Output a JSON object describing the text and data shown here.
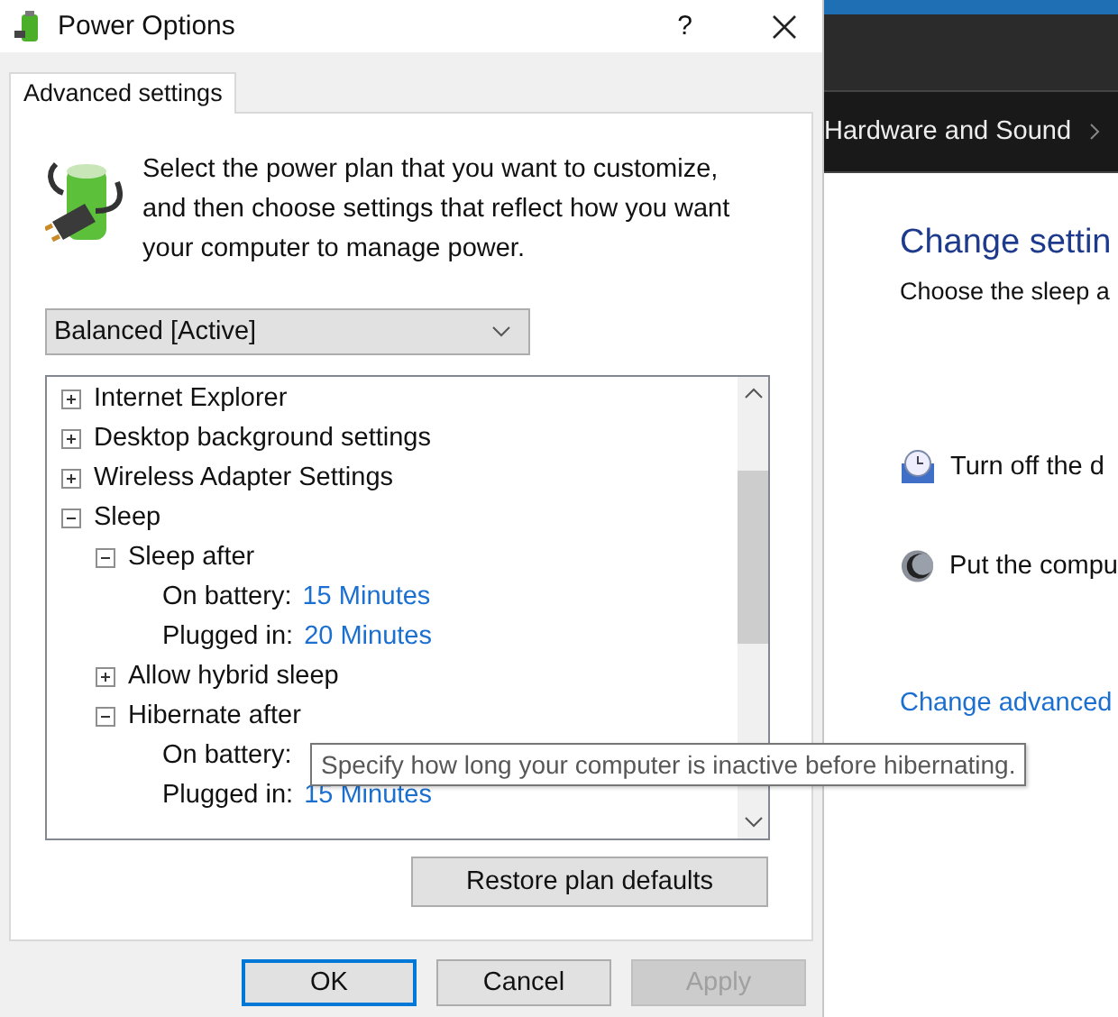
{
  "dialog": {
    "title": "Power Options",
    "help": "?",
    "tabs": [
      {
        "label": "Advanced settings",
        "selected": true
      }
    ],
    "intro": "Select the power plan that you want to customize, and then choose settings that reflect how you want your computer to manage power.",
    "plan_dropdown": {
      "value": "Balanced [Active]"
    },
    "tree": [
      {
        "kind": "group",
        "label": "Internet Explorer",
        "expanded": false
      },
      {
        "kind": "group",
        "label": "Desktop background settings",
        "expanded": false
      },
      {
        "kind": "group",
        "label": "Wireless Adapter Settings",
        "expanded": false
      },
      {
        "kind": "group",
        "label": "Sleep",
        "expanded": true,
        "children": [
          {
            "kind": "group",
            "label": "Sleep after",
            "expanded": true,
            "children": [
              {
                "kind": "setting",
                "label": "On battery:",
                "value": "15 Minutes"
              },
              {
                "kind": "setting",
                "label": "Plugged in:",
                "value": "20 Minutes"
              }
            ]
          },
          {
            "kind": "group",
            "label": "Allow hybrid sleep",
            "expanded": false
          },
          {
            "kind": "group",
            "label": "Hibernate after",
            "expanded": true,
            "children": [
              {
                "kind": "setting",
                "label": "On battery:"
              },
              {
                "kind": "setting",
                "label": "Plugged in:",
                "value": "15 Minutes"
              }
            ]
          }
        ]
      }
    ],
    "restore_button": "Restore plan defaults",
    "buttons": [
      {
        "label": "OK",
        "default": true,
        "disabled": false
      },
      {
        "label": "Cancel",
        "default": false,
        "disabled": false
      },
      {
        "label": "Apply",
        "default": false,
        "disabled": true
      }
    ]
  },
  "tooltip": "Specify how long your computer is inactive before hibernating.",
  "background_window": {
    "breadcrumb": "Hardware and Sound",
    "heading": "Change settin",
    "subtitle": "Choose the sleep a",
    "settings": [
      {
        "kind": "display",
        "label": "Turn off the d"
      },
      {
        "kind": "sleep",
        "label": "Put the compu"
      }
    ],
    "links": [
      "Change advanced"
    ]
  }
}
